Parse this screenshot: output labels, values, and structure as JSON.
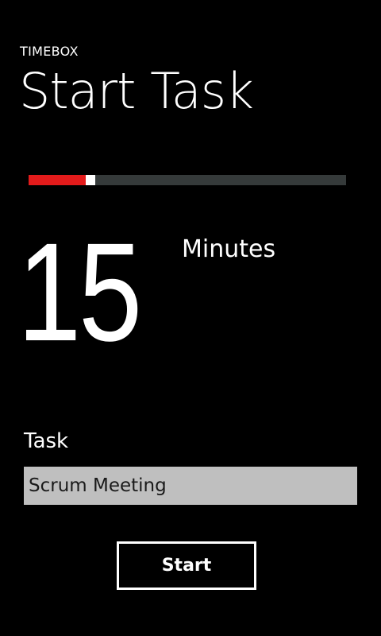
{
  "app": {
    "title": "TIMEBOX"
  },
  "page": {
    "title": "Start Task"
  },
  "duration": {
    "value": "15",
    "unit": "Minutes",
    "slider_fraction": 0.18,
    "colors": {
      "fill": "#e31b1b",
      "track": "#353a3a",
      "thumb": "#ffffff"
    }
  },
  "task": {
    "label": "Task",
    "value": "Scrum Meeting"
  },
  "actions": {
    "start_label": "Start"
  }
}
